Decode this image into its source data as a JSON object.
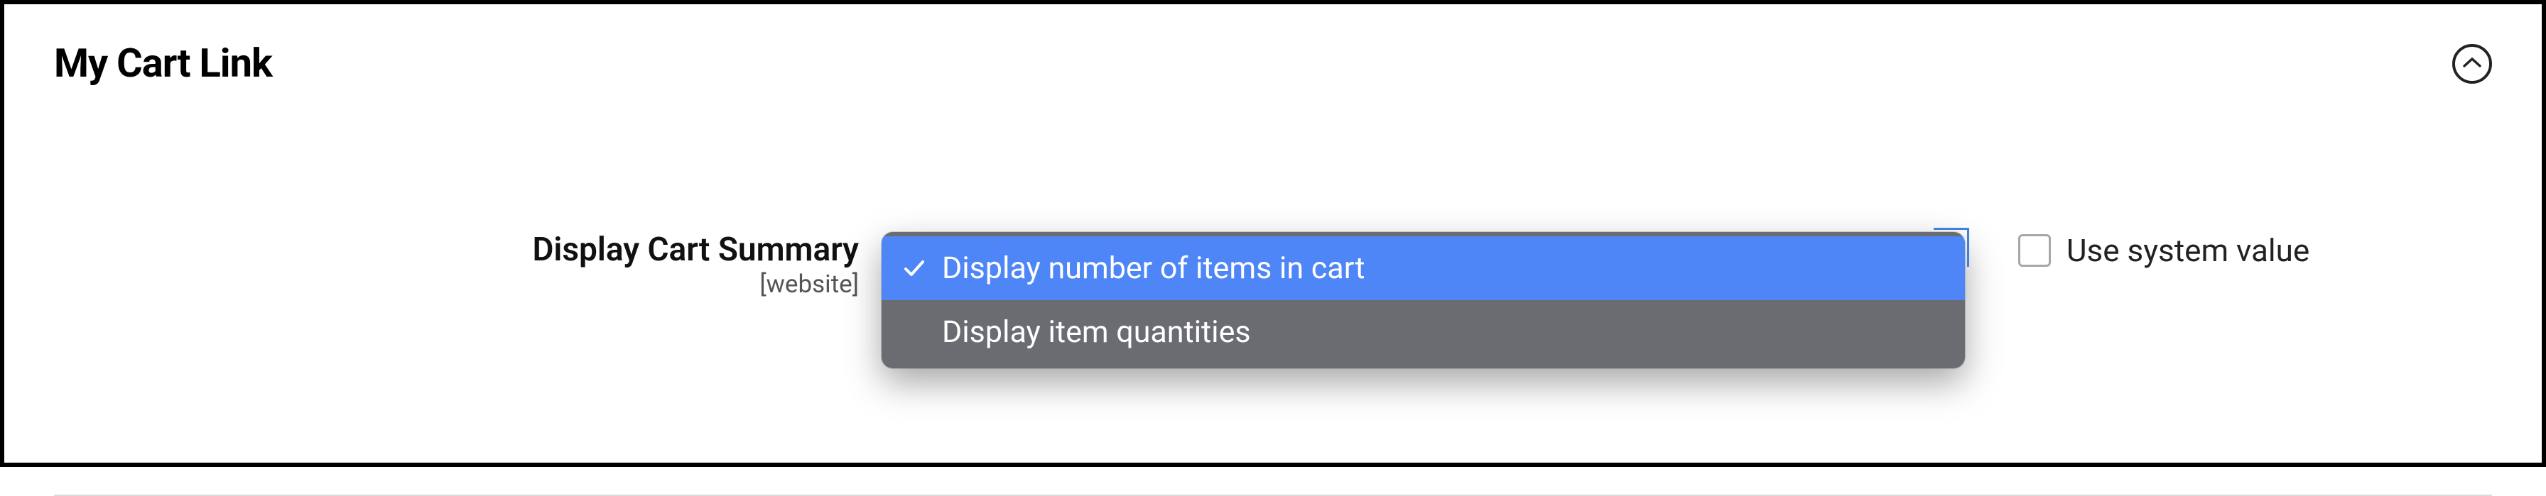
{
  "section": {
    "title": "My Cart Link"
  },
  "field": {
    "label": "Display Cart Summary",
    "scope": "[website]",
    "options": [
      "Display number of items in cart",
      "Display item quantities"
    ],
    "selected_index": 0
  },
  "use_system": {
    "label": "Use system value",
    "checked": false
  },
  "icons": {
    "collapse": "chevron-up",
    "check": "checkmark"
  }
}
